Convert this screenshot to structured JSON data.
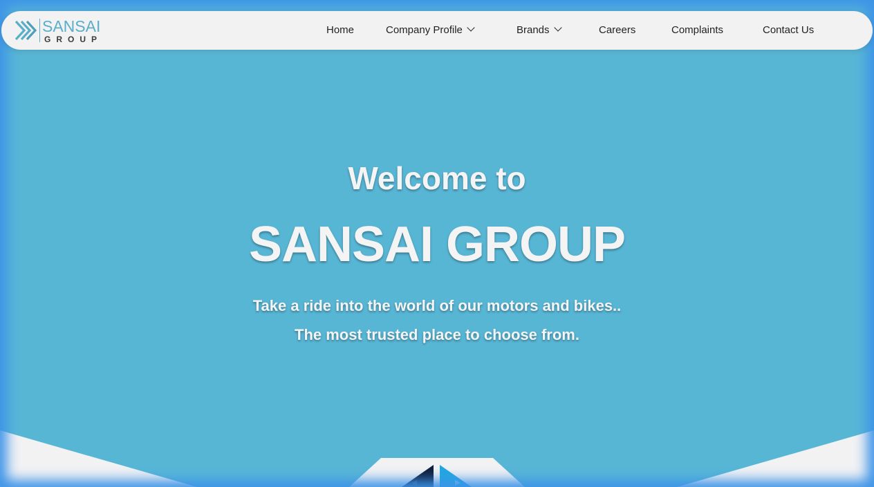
{
  "brand": {
    "name": "SANSAI",
    "sub": "GROUP",
    "logo_icon": "chevron-stack-logo-icon",
    "accent_color": "#5aaec9"
  },
  "nav": {
    "items": [
      {
        "label": "Home",
        "has_dropdown": false
      },
      {
        "label": "Company Profile",
        "has_dropdown": true
      },
      {
        "label": "Brands",
        "has_dropdown": true
      },
      {
        "label": "Careers",
        "has_dropdown": false
      },
      {
        "label": "Complaints",
        "has_dropdown": false
      },
      {
        "label": "Contact Us",
        "has_dropdown": false
      }
    ]
  },
  "hero": {
    "welcome": "Welcome to",
    "title": "SANSAI GROUP",
    "tagline_1": "Take a ride into the world of our motors and bikes..",
    "tagline_2": "The most trusted place to choose from.",
    "background_color": "#58b6d5"
  },
  "slider": {
    "prev_icon": "prev-arrow-icon",
    "next_icon": "next-arrow-icon"
  }
}
